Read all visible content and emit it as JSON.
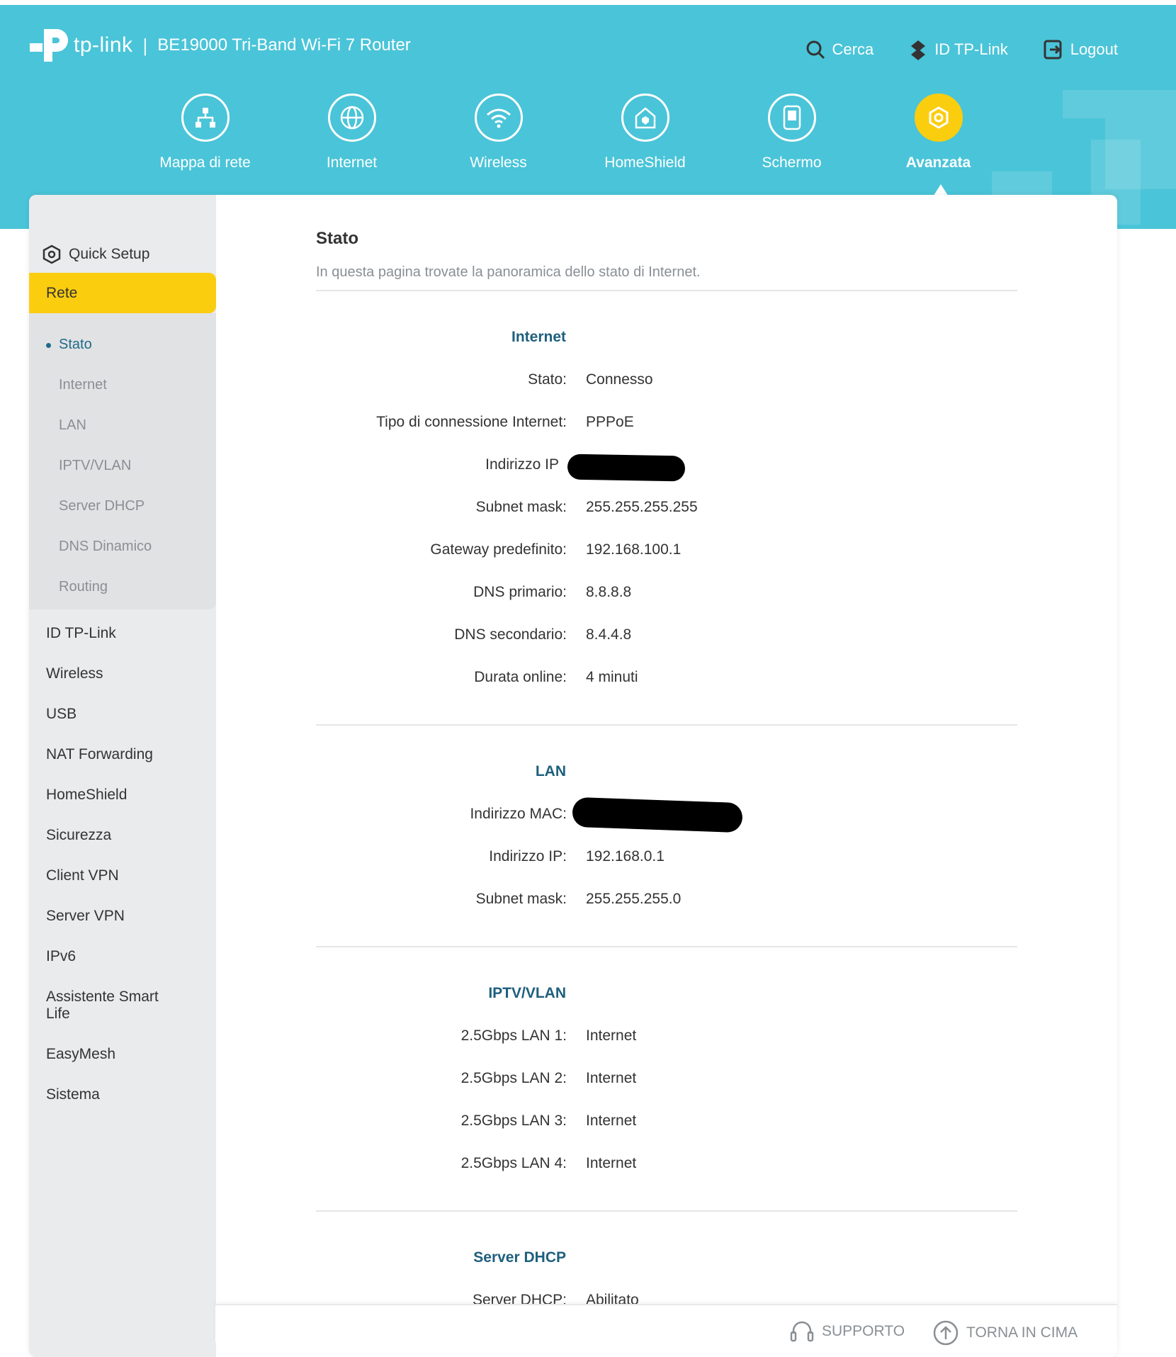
{
  "brand": {
    "logo_text": "tp-link",
    "model": "BE19000 Tri-Band Wi-Fi 7 Router"
  },
  "top_nav": {
    "search": "Cerca",
    "tplink_id": "ID TP-Link",
    "logout": "Logout"
  },
  "main_nav": [
    {
      "label": "Mappa di rete",
      "icon": "network-map-icon"
    },
    {
      "label": "Internet",
      "icon": "globe-icon"
    },
    {
      "label": "Wireless",
      "icon": "wifi-icon"
    },
    {
      "label": "HomeShield",
      "icon": "homeshield-icon"
    },
    {
      "label": "Schermo",
      "icon": "screen-icon"
    },
    {
      "label": "Avanzata",
      "icon": "gear-icon",
      "active": true
    }
  ],
  "sidebar": {
    "quick_setup": "Quick Setup",
    "active_section": "Rete",
    "sub_items": [
      "Stato",
      "Internet",
      "LAN",
      "IPTV/VLAN",
      "Server DHCP",
      "DNS Dinamico",
      "Routing"
    ],
    "active_sub": "Stato",
    "items": [
      "ID TP-Link",
      "Wireless",
      "USB",
      "NAT Forwarding",
      "HomeShield",
      "Sicurezza",
      "Client VPN",
      "Server VPN",
      "IPv6",
      "Assistente Smart Life",
      "EasyMesh",
      "Sistema"
    ]
  },
  "page": {
    "title": "Stato",
    "description": "In questa pagina trovate la panoramica dello stato di Internet."
  },
  "internet": {
    "heading": "Internet",
    "status_label": "Stato:",
    "status_value": "Connesso",
    "conn_type_label": "Tipo di connessione Internet:",
    "conn_type_value": "PPPoE",
    "ip_label": "Indirizzo IP",
    "subnet_label": "Subnet mask:",
    "subnet_value": "255.255.255.255",
    "gateway_label": "Gateway predefinito:",
    "gateway_value": "192.168.100.1",
    "dns1_label": "DNS primario:",
    "dns1_value": "8.8.8.8",
    "dns2_label": "DNS secondario:",
    "dns2_value": "8.4.4.8",
    "uptime_label": "Durata online:",
    "uptime_value": "4 minuti"
  },
  "lan": {
    "heading": "LAN",
    "mac_label": "Indirizzo MAC:",
    "ip_label": "Indirizzo IP:",
    "ip_value": "192.168.0.1",
    "subnet_label": "Subnet mask:",
    "subnet_value": "255.255.255.0"
  },
  "iptv": {
    "heading": "IPTV/VLAN",
    "ports": [
      {
        "label": "2.5Gbps LAN 1:",
        "value": "Internet"
      },
      {
        "label": "2.5Gbps LAN 2:",
        "value": "Internet"
      },
      {
        "label": "2.5Gbps LAN 3:",
        "value": "Internet"
      },
      {
        "label": "2.5Gbps LAN 4:",
        "value": "Internet"
      }
    ]
  },
  "dhcp": {
    "heading": "Server DHCP",
    "server_label": "Server DHCP:",
    "server_value": "Abilitato"
  },
  "footer": {
    "support": "SUPPORTO",
    "back_to_top": "TORNA IN CIMA"
  },
  "colors": {
    "header_bg": "#4ac4d8",
    "accent_yellow": "#fbcd0f",
    "heading_blue": "#1e5f7d",
    "sidebar_bg": "#eaebec"
  }
}
